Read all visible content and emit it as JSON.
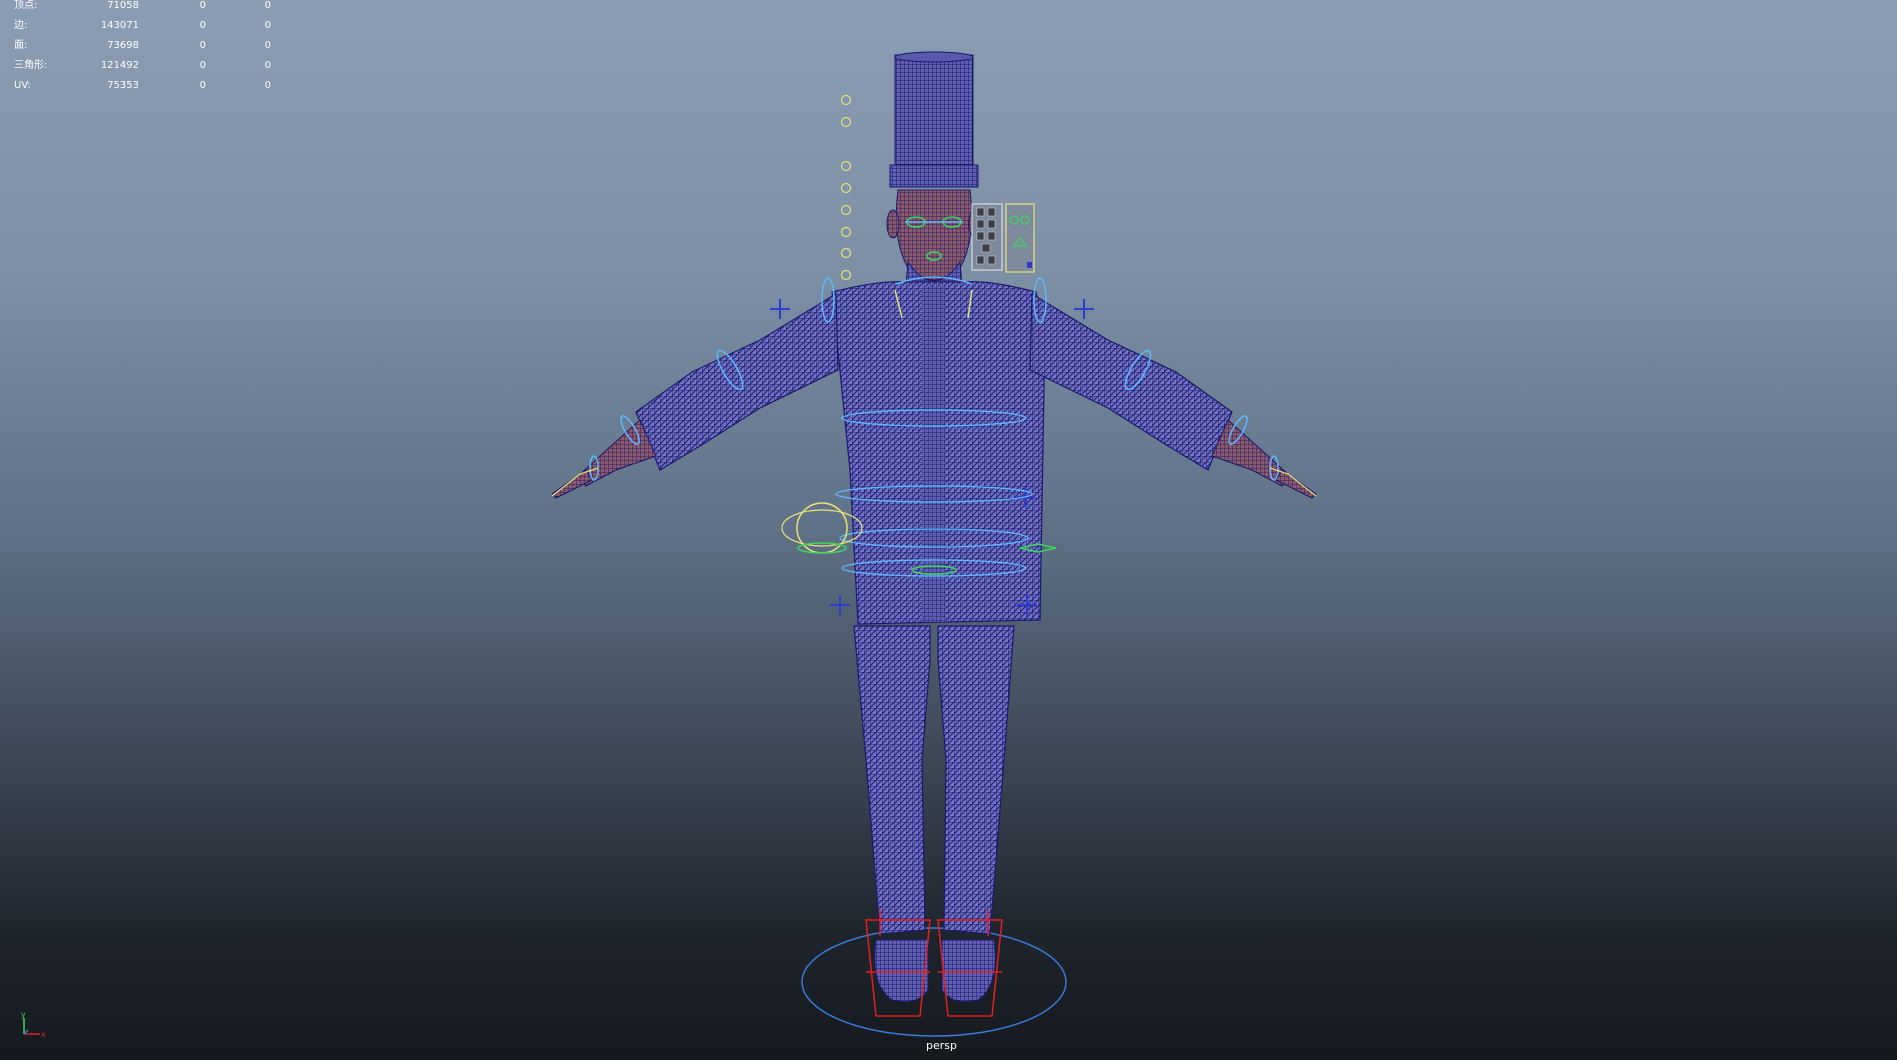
{
  "hud": {
    "rows": [
      {
        "label": "顶点:",
        "v1": "71058",
        "v2": "0",
        "v3": "0"
      },
      {
        "label": "边:",
        "v1": "143071",
        "v2": "0",
        "v3": "0"
      },
      {
        "label": "面:",
        "v1": "73698",
        "v2": "0",
        "v3": "0"
      },
      {
        "label": "三角形:",
        "v1": "121492",
        "v2": "0",
        "v3": "0"
      },
      {
        "label": "UV:",
        "v1": "75353",
        "v2": "0",
        "v3": "0"
      }
    ]
  },
  "viewport": {
    "camera_label": "persp",
    "axis_y": "y",
    "axis_x": "x",
    "colors": {
      "mesh": "#1e1e78",
      "mesh_fill": "#3a3aa0",
      "ctrl_light_blue": "#5fb8ff",
      "ctrl_yellow": "#e8e27a",
      "ctrl_green": "#3cd65a",
      "ctrl_red": "#e02020",
      "ctrl_blue_cross": "#2f3ad0"
    },
    "icons": [
      "axis-gizmo-icon"
    ]
  }
}
